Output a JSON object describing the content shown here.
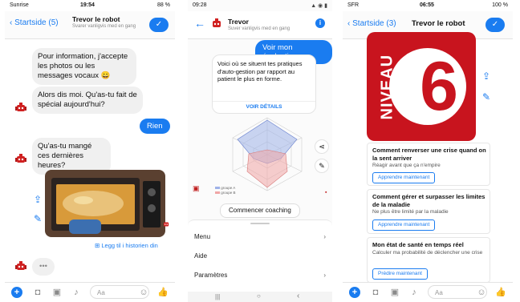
{
  "colors": {
    "accent": "#1a7cf0",
    "level_red": "#c8141e",
    "bubble_gray": "#f0f0f0"
  },
  "screen1": {
    "status": {
      "carrier": "Sunrise",
      "time": "19:54",
      "battery": "88 %"
    },
    "nav": {
      "back_label": "Startside (5)",
      "title": "Trevor le robot",
      "subtitle": "Svarer vanligvis med en gang"
    },
    "messages": [
      "Pour information, j'accepte les photos ou les messages vocaux 😀",
      "Alors dis moi. Qu'as-tu fait de spécial aujourd'hui?",
      "Rien",
      "Qu'as-tu mangé ces dernières heures?"
    ],
    "photo_link": "Legg til i historien din",
    "typing": "•••",
    "composer": {
      "placeholder": "Aa"
    }
  },
  "screen2": {
    "status": {
      "time": "09:28"
    },
    "header": {
      "name": "Trevor",
      "subtitle": "Suver vanligvis med en gang"
    },
    "user_message": "Voir mon évaluation",
    "card_text": "Voici où se situent tes pratiques d'auto-gestion par rapport au patient le plus en forme.",
    "card_link": "VOIR DÉTAILS",
    "chart_legend": [
      "groupe A",
      "groupe B"
    ],
    "quick_reply": "Commencer coaching",
    "drawer": [
      "Menu",
      "Aide",
      "Paramètres"
    ]
  },
  "screen3": {
    "status": {
      "carrier": "SFR",
      "time": "06:55",
      "battery": "100 %"
    },
    "nav": {
      "back_label": "Startside (3)",
      "title": "Trevor le robot"
    },
    "logo": {
      "word": "NIVEAU",
      "number": "6"
    },
    "cards": [
      {
        "title": "Comment renverser une crise quand on la sent arriver",
        "subtitle": "Réagir avant que ça n'empire",
        "button": "Apprendre maintenant"
      },
      {
        "title": "Comment gérer et surpasser les limites de la maladie",
        "subtitle": "Ne plus être limité par la maladie",
        "button": "Apprendre maintenant"
      },
      {
        "title": "Mon état de santé en temps réel",
        "subtitle": "Calculer ma probabilité de déclencher une crise",
        "button": "Prédire maintenant"
      }
    ],
    "composer": {
      "placeholder": "Aa"
    }
  }
}
